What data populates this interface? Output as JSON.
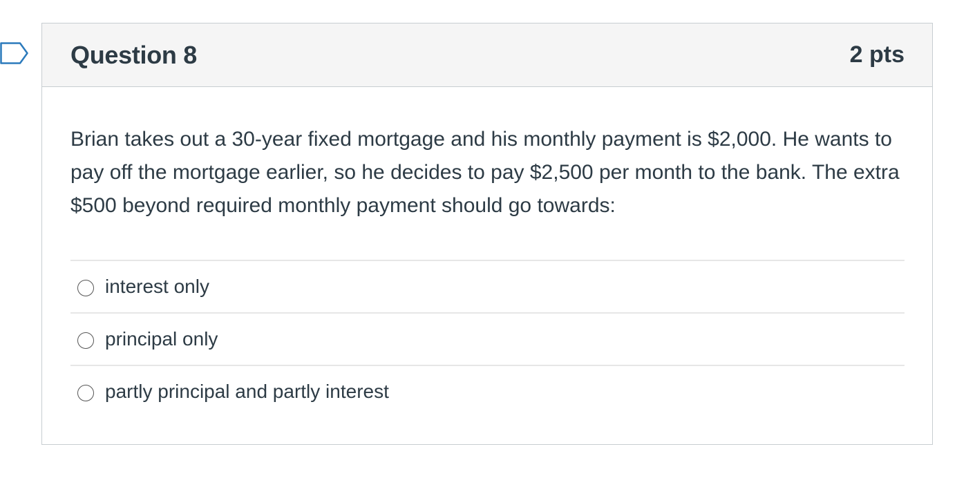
{
  "question": {
    "title": "Question 8",
    "points": "2 pts",
    "text": "Brian takes out a 30-year fixed mortgage and his monthly payment is $2,000. He wants to pay off the mortgage earlier, so he decides to pay $2,500 per month to the bank. The extra $500 beyond required monthly payment should go towards:",
    "answers": [
      {
        "label": "interest only",
        "selected": false
      },
      {
        "label": "principal only",
        "selected": false
      },
      {
        "label": "partly principal and partly interest",
        "selected": false
      }
    ]
  },
  "icons": {
    "flag": "flag-icon"
  },
  "colors": {
    "text": "#2d3b45",
    "header_bg": "#f5f5f5",
    "border": "#c7cdd1",
    "divider": "#e6e6e6",
    "flag_outline": "#2b7abc"
  }
}
